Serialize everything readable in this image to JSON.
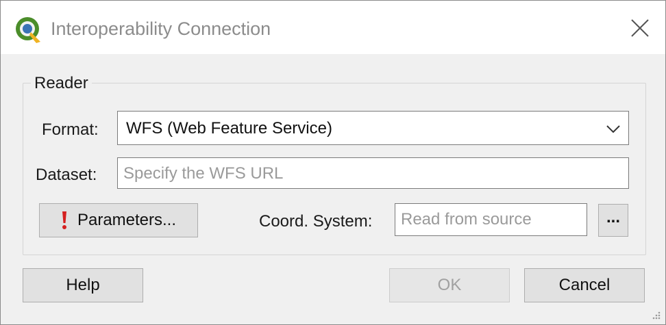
{
  "window": {
    "title": "Interoperability Connection",
    "icon": "qgis-logo-icon",
    "close_icon": "close-icon"
  },
  "reader": {
    "group_label": "Reader",
    "format_label": "Format:",
    "format_value": "WFS (Web Feature Service)",
    "dataset_label": "Dataset:",
    "dataset_placeholder": "Specify the WFS URL",
    "parameters_label": "Parameters...",
    "parameters_icon": "exclamation-warning-icon",
    "coord_label": "Coord. System:",
    "coord_placeholder": "Read from source",
    "browse_label": "..."
  },
  "footer": {
    "help_label": "Help",
    "ok_label": "OK",
    "cancel_label": "Cancel"
  },
  "colors": {
    "accent_warning": "#d42020",
    "disabled_text": "#a0a0a0",
    "title_text": "#8c8c8c"
  }
}
